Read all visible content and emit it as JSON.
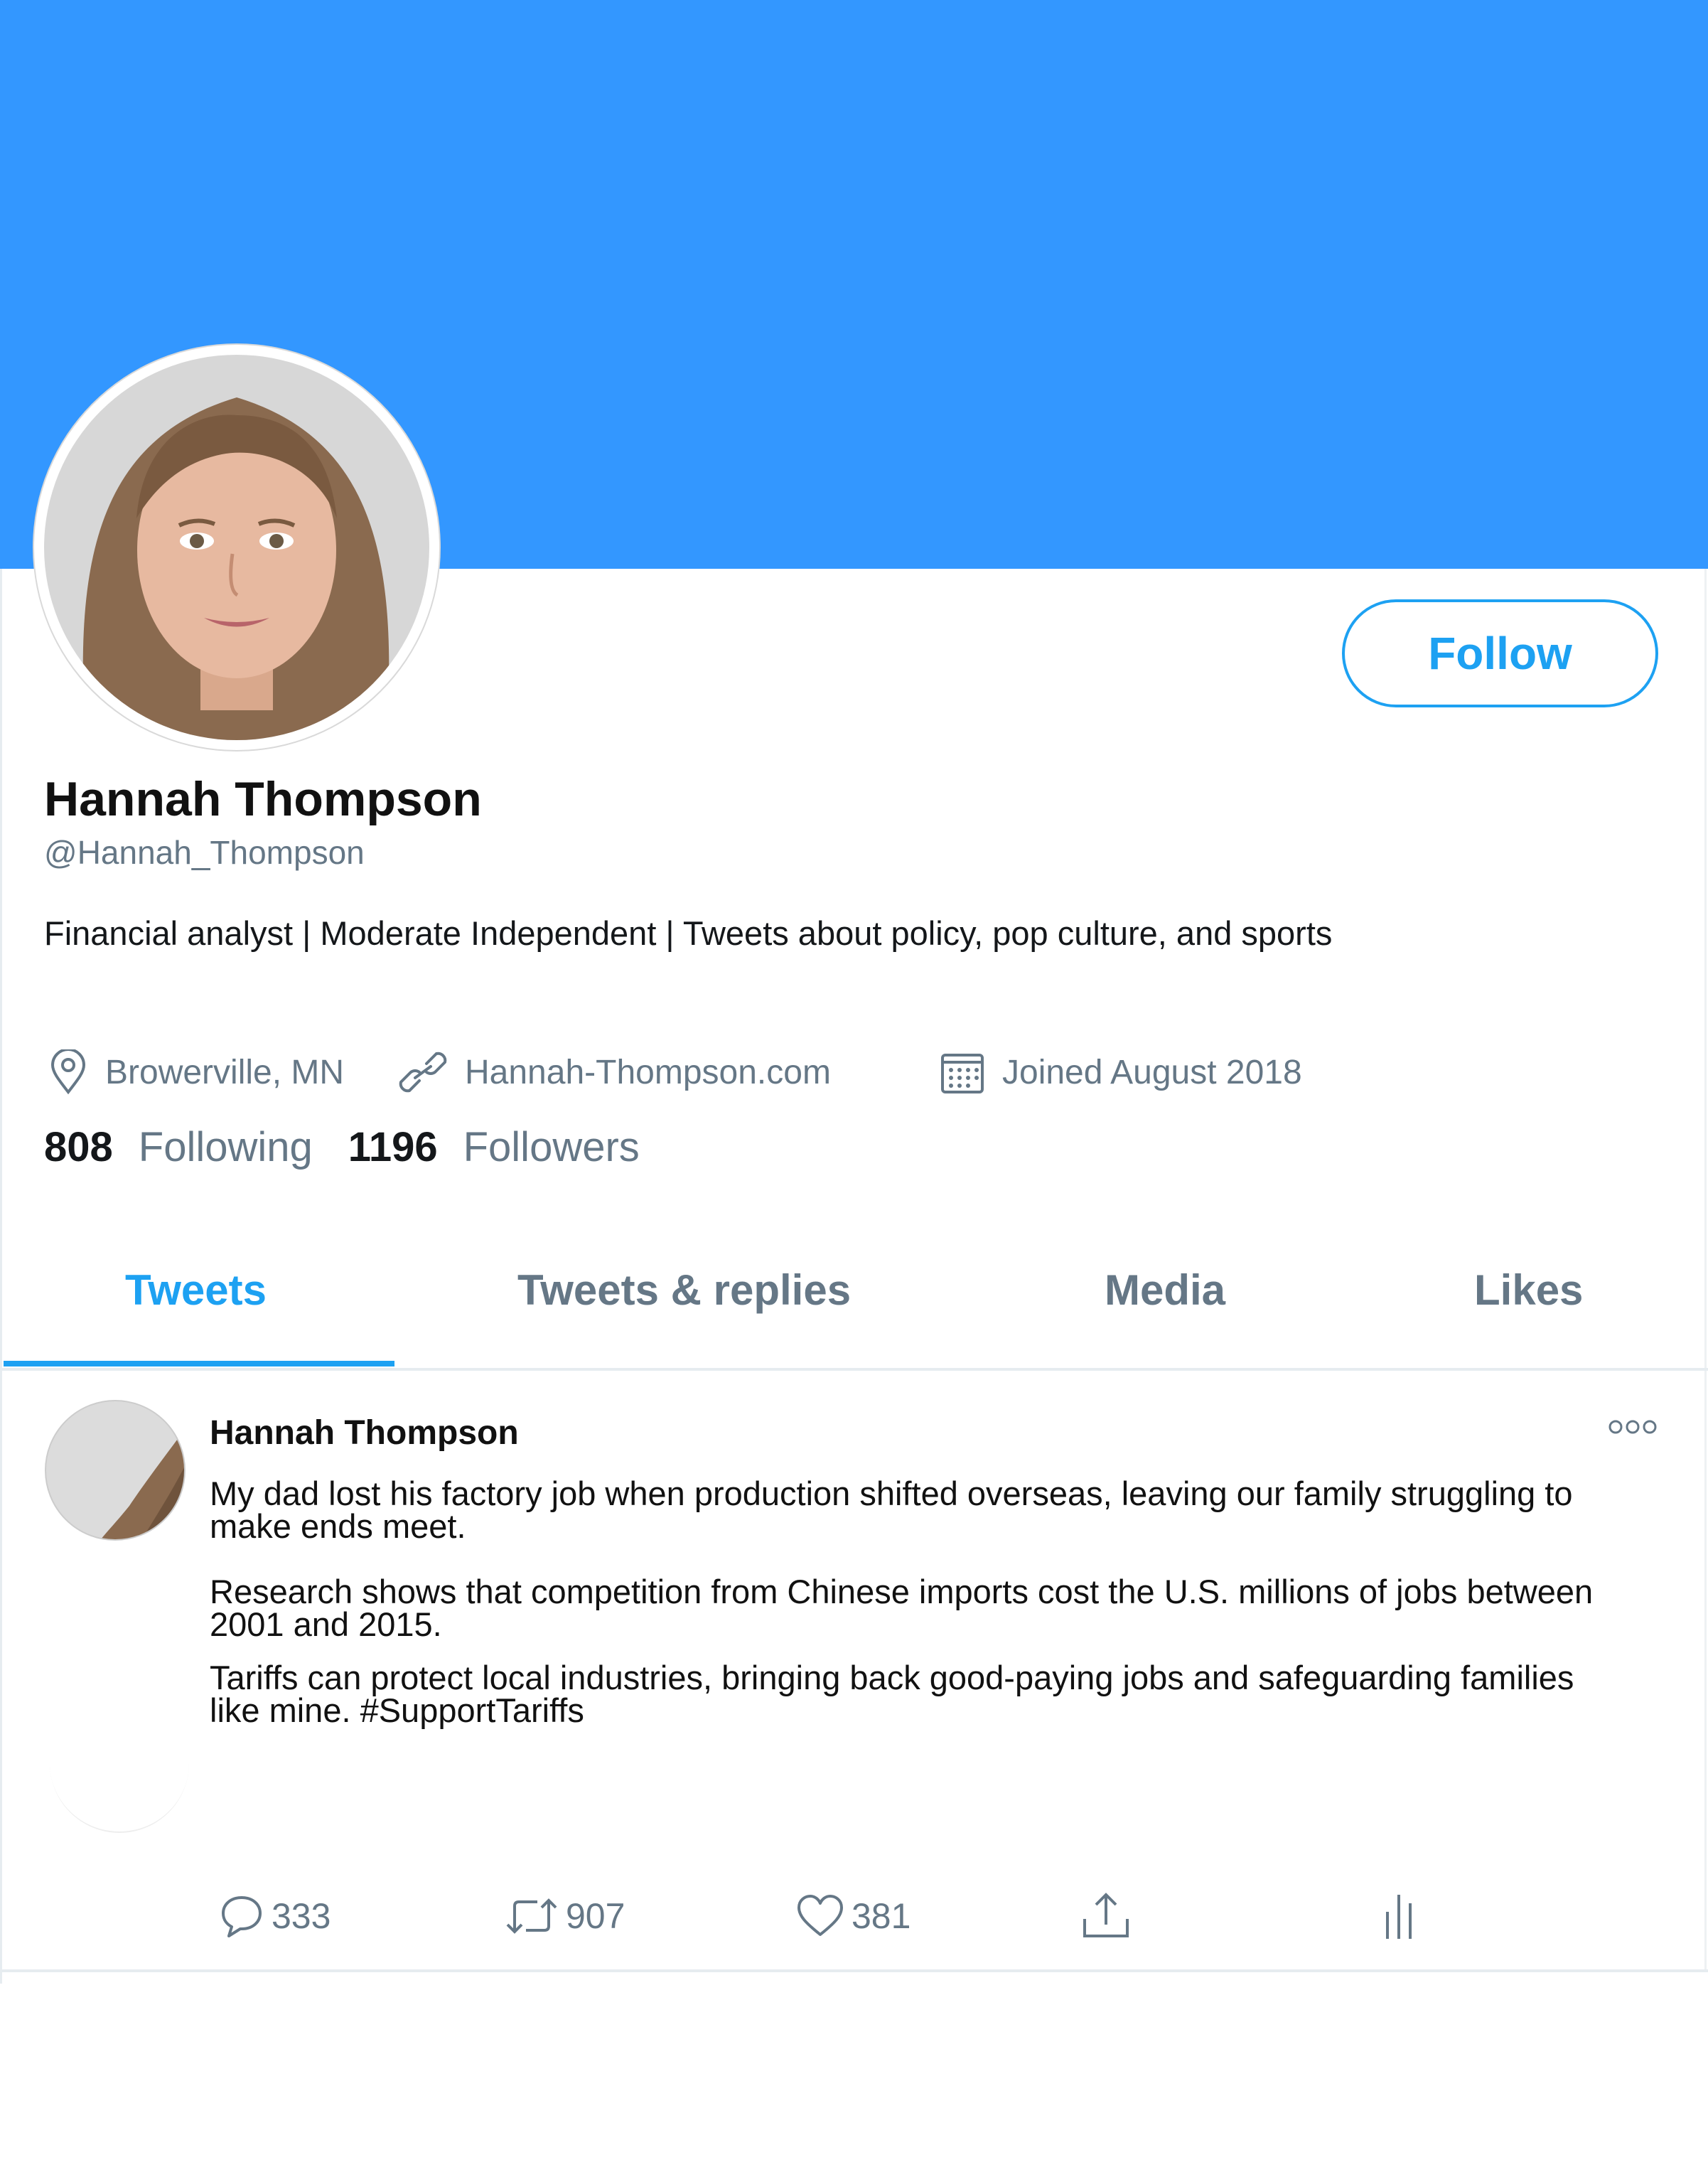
{
  "profile": {
    "name": "Hannah Thompson",
    "handle": "@Hannah_Thompson",
    "bio": "Financial analyst | Moderate Independent | Tweets about policy, pop culture, and sports",
    "location": "Browerville, MN",
    "website": "Hannah-Thompson.com",
    "joined": "Joined August 2018",
    "following_count": "808",
    "following_label": "Following",
    "followers_count": "1196",
    "followers_label": "Followers",
    "follow_label": "Follow"
  },
  "tabs": [
    {
      "label": "Tweets",
      "active": true
    },
    {
      "label": "Tweets & replies",
      "active": false
    },
    {
      "label": "Media",
      "active": false
    },
    {
      "label": "Likes",
      "active": false
    }
  ],
  "tweet": {
    "author": "Hannah Thompson",
    "paragraphs": [
      "My dad lost his factory job when production shifted overseas, leaving our family struggling to make ends meet.",
      "Research shows that competition from Chinese imports cost the U.S. millions of jobs between 2001 and 2015.",
      "Tariffs can protect local industries, bringing back good-paying jobs and safeguarding families like mine. #SupportTariffs"
    ],
    "replies": "333",
    "retweets": "907",
    "likes": "381"
  },
  "icons": [
    "location-pin-icon",
    "link-icon",
    "calendar-icon",
    "more-icon",
    "reply-icon",
    "retweet-icon",
    "like-icon",
    "share-icon",
    "analytics-icon"
  ],
  "colors": {
    "banner": "#3397ff",
    "accent": "#1da1f2",
    "muted": "#657786"
  }
}
